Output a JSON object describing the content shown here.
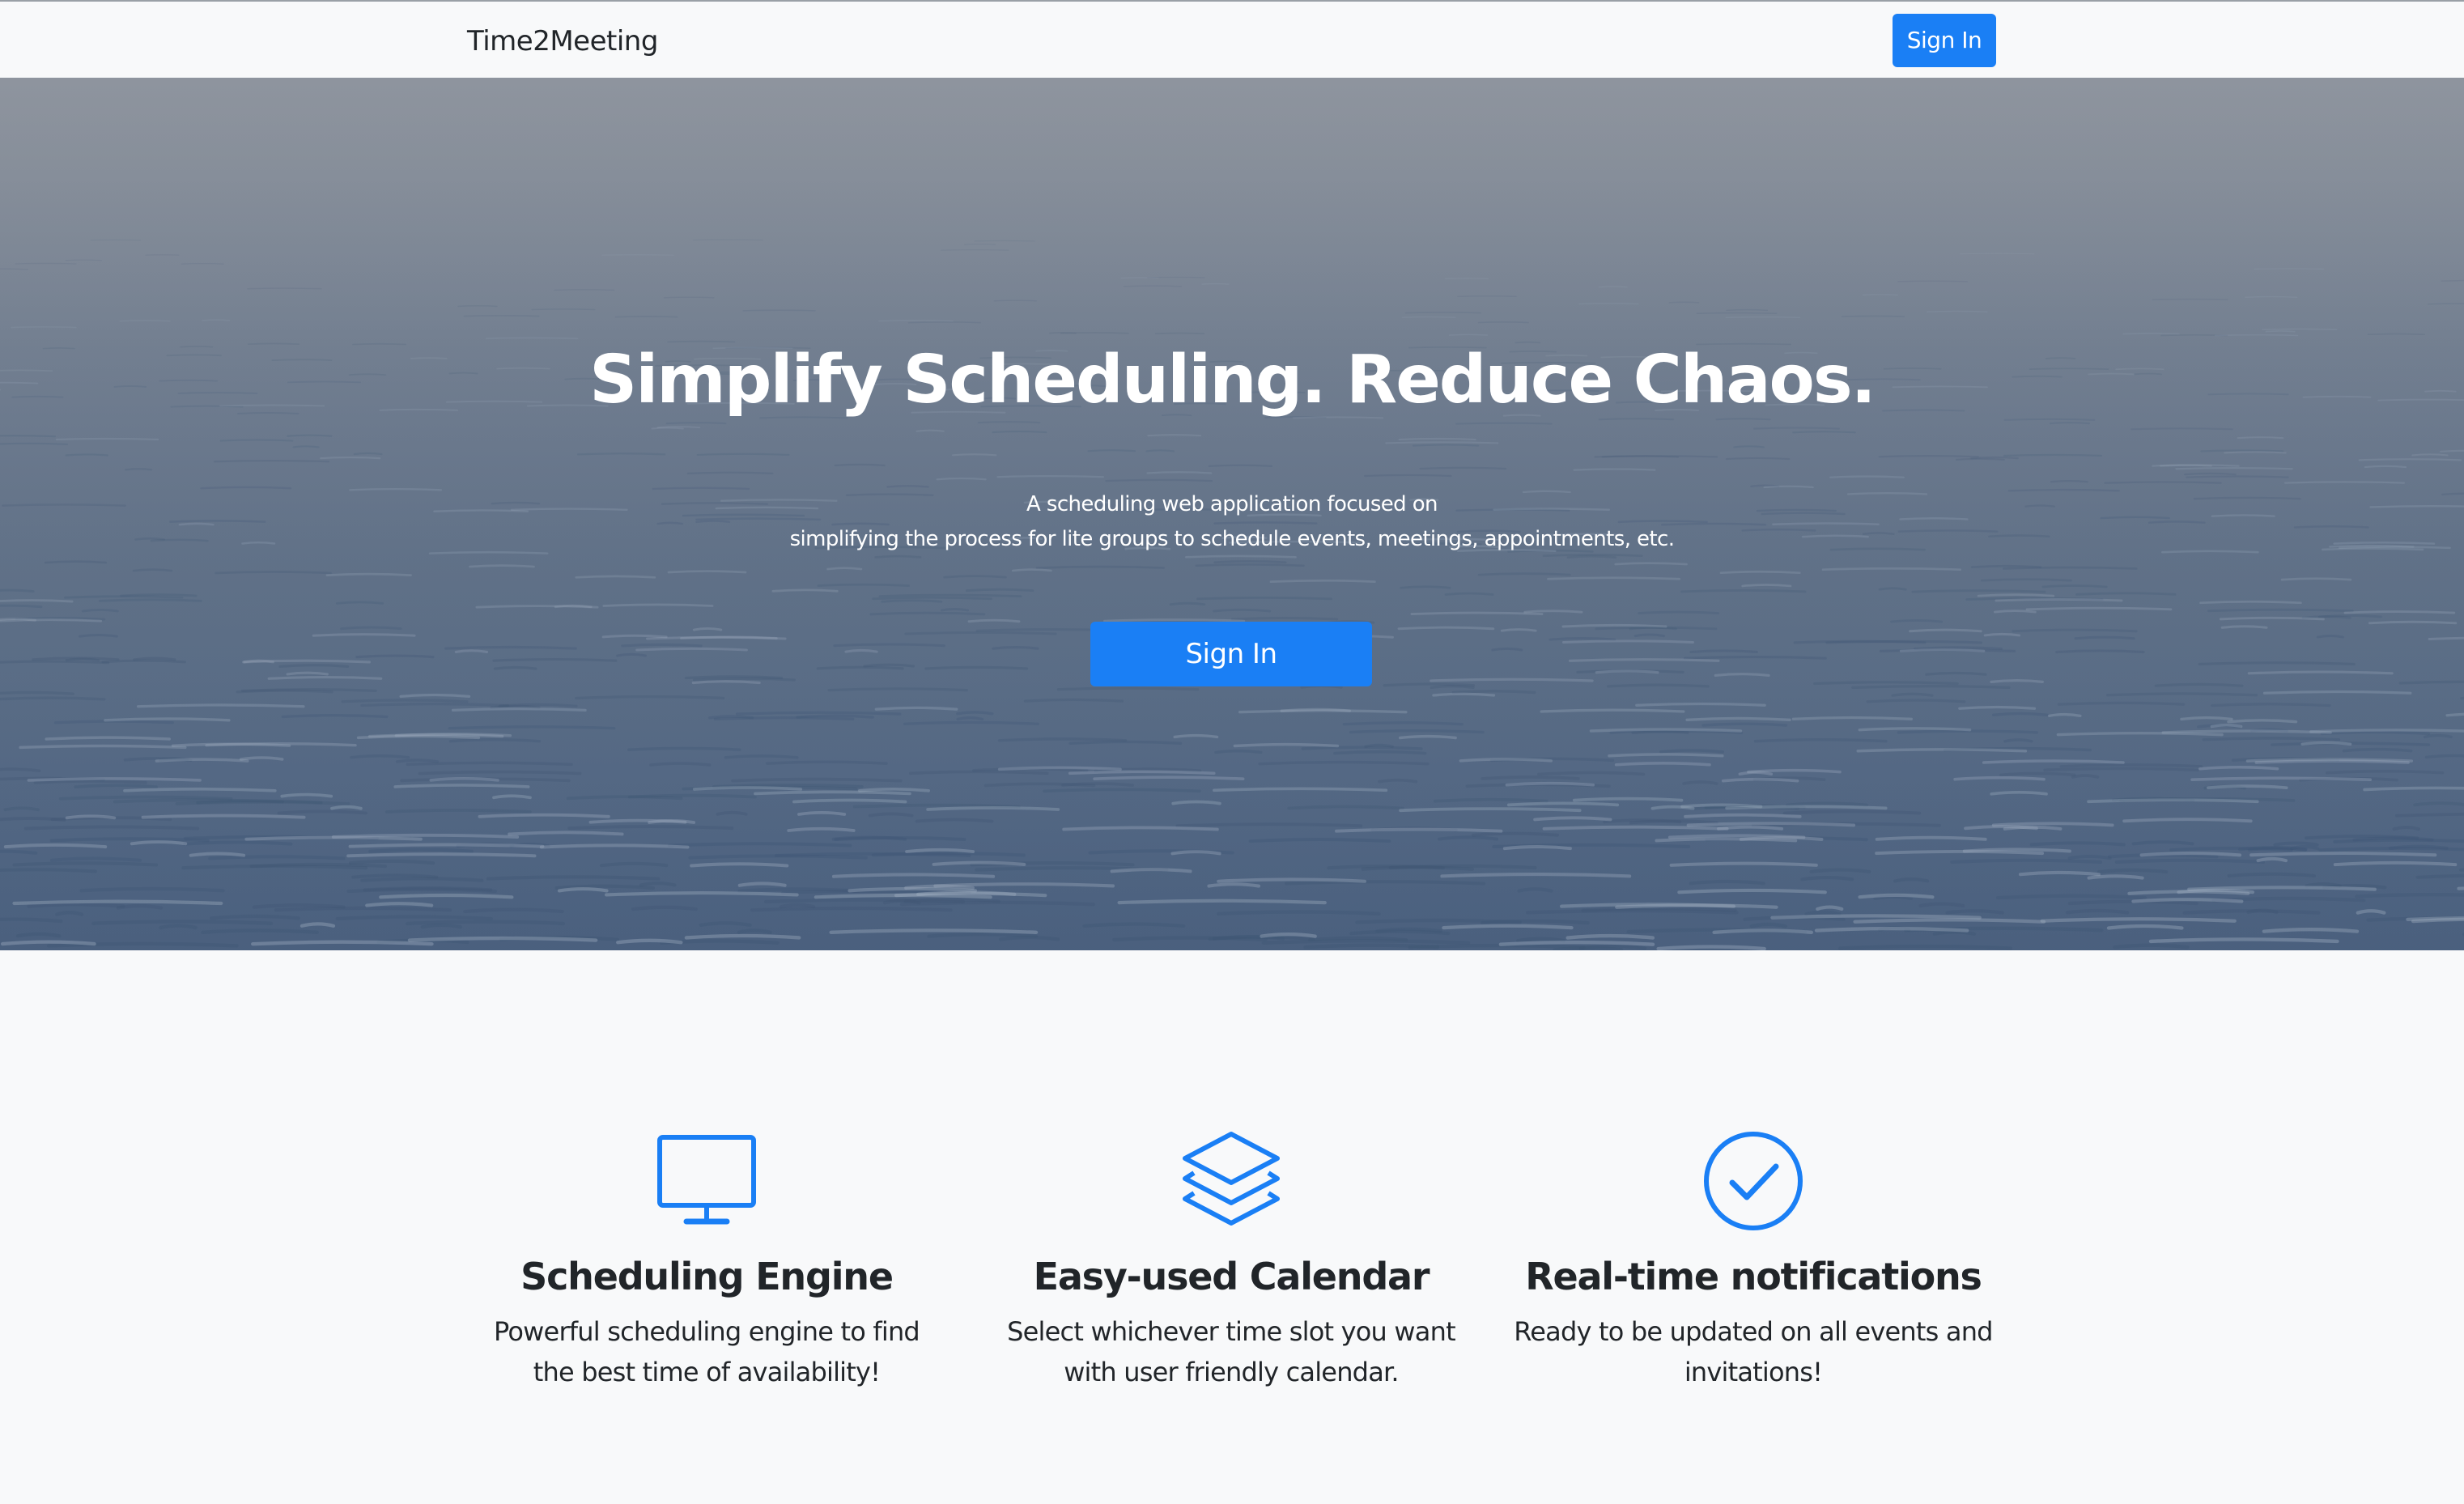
{
  "navbar": {
    "brand": "Time2Meeting",
    "signin_label": "Sign In"
  },
  "hero": {
    "title": "Simplify Scheduling. Reduce Chaos.",
    "description_line1": "A scheduling web application focused on",
    "description_line2": "simplifying the process for lite groups to schedule events, meetings, appointments, etc.",
    "signin_label": "Sign In"
  },
  "features": [
    {
      "icon": "desktop-monitor-icon",
      "title": "Scheduling Engine",
      "text_line1": "Powerful scheduling engine to find",
      "text_line2": "the best time of availability!"
    },
    {
      "icon": "layers-icon",
      "title": "Easy-used Calendar",
      "text_line1": "Select whichever time slot you want",
      "text_line2": "with user friendly calendar."
    },
    {
      "icon": "check-circle-icon",
      "title": "Real-time notifications",
      "text_line1": "Ready to be updated on all events and",
      "text_line2": "invitations!"
    }
  ],
  "colors": {
    "accent": "#1a7ff5",
    "page_background": "#f8f9fa",
    "text": "#212529",
    "hero_text": "#ffffff"
  }
}
